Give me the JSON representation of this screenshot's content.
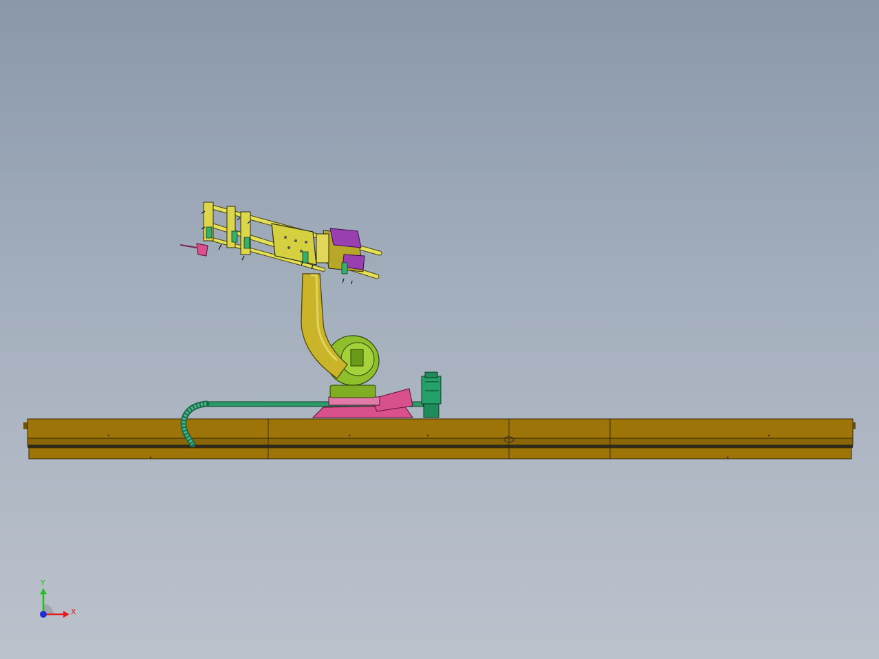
{
  "viewport": {
    "background_top": "#8a98aa",
    "background_bottom": "#bcc2cc"
  },
  "model": {
    "colors": {
      "rail": "#9c7408",
      "rail_dark": "#6e5206",
      "arm": "#c9b42a",
      "arm_light": "#e2d65a",
      "gripper": "#e6e15a",
      "base_green": "#7fae25",
      "pedestal": "#d8508c",
      "cable_green": "#2e9a6a",
      "motor_green": "#25a06a",
      "purple": "#9a3fb0"
    }
  },
  "triad": {
    "x_label": "X",
    "y_label": "Y",
    "x_color": "#e02020",
    "y_color": "#20c020",
    "z_color": "#2030d0"
  }
}
